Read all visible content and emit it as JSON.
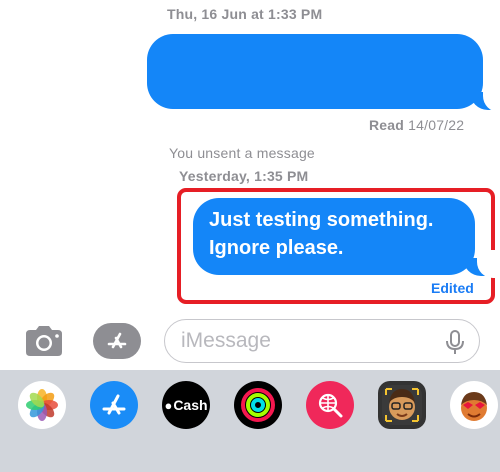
{
  "messages": {
    "timestamp_1": "Thu, 16 Jun at 1:33 PM",
    "read_receipt_label": "Read",
    "read_receipt_date": "14/07/22",
    "unsent_notice": "You unsent a message",
    "timestamp_2": "Yesterday, 1:35 PM",
    "edited_message_text": "Just testing something. Ignore please.",
    "edited_label": "Edited"
  },
  "input": {
    "placeholder": "iMessage"
  },
  "app_drawer": {
    "cash_label": "Cash",
    "apps": [
      "photos-icon",
      "app-store-icon",
      "apple-cash-icon",
      "activity-icon",
      "web-search-icon",
      "memoji-icon",
      "memoji-stickers-icon"
    ]
  },
  "colors": {
    "bubble": "#1486f8",
    "highlight": "#e61e25",
    "meta": "#8e8e93",
    "drawer": "#d1d5db"
  }
}
